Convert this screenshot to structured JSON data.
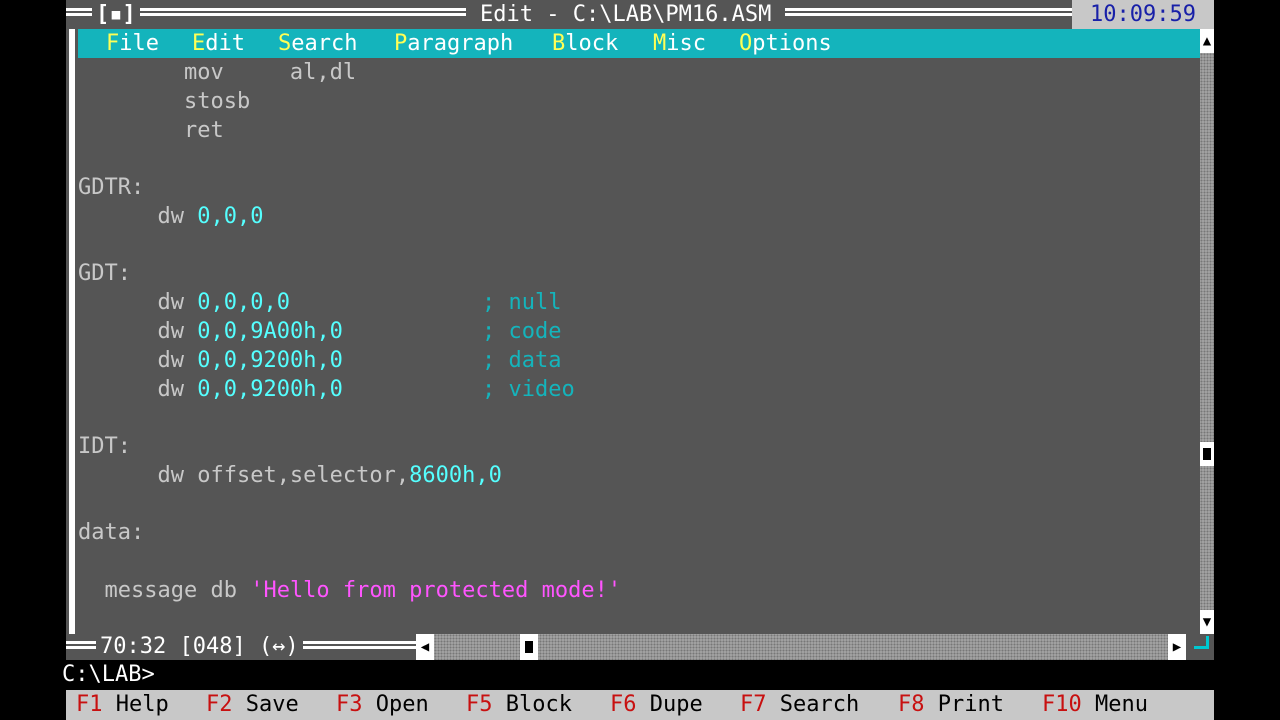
{
  "window": {
    "close_box": "[▪]",
    "title": "Edit - C:\\LAB\\PM16.ASM",
    "clock": "10:09:59"
  },
  "menu": {
    "items": [
      {
        "hot": "F",
        "rest": "ile"
      },
      {
        "hot": "E",
        "rest": "dit"
      },
      {
        "hot": "S",
        "rest": "earch"
      },
      {
        "hot": "P",
        "rest": "aragraph"
      },
      {
        "hot": "B",
        "rest": "lock"
      },
      {
        "hot": "M",
        "rest": "isc"
      },
      {
        "hot": "O",
        "rest": "ptions"
      }
    ]
  },
  "editor": {
    "lines": [
      {
        "indent": "        ",
        "text": "mov     al,dl"
      },
      {
        "indent": "        ",
        "text": "stosb"
      },
      {
        "indent": "        ",
        "text": "ret"
      },
      {
        "label": "GDTR:"
      },
      {
        "indent": "      ",
        "op": "dw ",
        "nums": "0,0,0"
      },
      {
        "label": "GDT:"
      },
      {
        "indent": "      ",
        "op": "dw ",
        "nums": "0,0,0,0",
        "comment": "; null"
      },
      {
        "indent": "      ",
        "op": "dw ",
        "nums": "0,0,9A00h,0",
        "comment": "; code"
      },
      {
        "indent": "      ",
        "op": "dw ",
        "nums": "0,0,9200h,0",
        "comment": "; data"
      },
      {
        "indent": "      ",
        "op": "dw ",
        "nums": "0,0,9200h,0",
        "comment": "; video"
      },
      {
        "label": "IDT:"
      },
      {
        "indent": "      ",
        "op": "dw offset,selector,",
        "nums": "8600h,0"
      },
      {
        "label": "data:"
      },
      {
        "indent": "  ",
        "op": "message db ",
        "string": "'Hello from protected mode!'"
      }
    ]
  },
  "status": {
    "position": "70:32 [048] (↔)"
  },
  "scroll": {
    "up_icon": "▲",
    "down_icon": "▼",
    "left_icon": "◀",
    "right_icon": "▶",
    "vertical_position": 0.73,
    "horizontal_position": 0.12
  },
  "prompt": "C:\\LAB>",
  "fkeys": [
    {
      "key": "F1",
      "label": "Help"
    },
    {
      "key": "F2",
      "label": "Save"
    },
    {
      "key": "F3",
      "label": "Open"
    },
    {
      "key": "F5",
      "label": "Block"
    },
    {
      "key": "F6",
      "label": "Dupe"
    },
    {
      "key": "F7",
      "label": "Search"
    },
    {
      "key": "F8",
      "label": "Print"
    },
    {
      "key": "F10",
      "label": "Menu"
    }
  ],
  "colors": {
    "editor_bg": "#555555",
    "menu_bg": "#14b4bc",
    "hotkey": "#ffff55",
    "number": "#55ffff",
    "comment": "#14b4bc",
    "string": "#ff55ff",
    "fkey": "#c81010"
  }
}
